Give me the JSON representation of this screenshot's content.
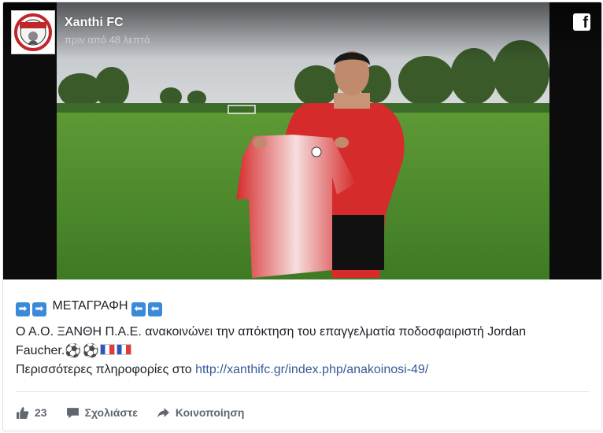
{
  "post": {
    "page_name": "Xanthi FC",
    "time": "πριν από 48 λεπτά",
    "logo_text": "ΞΑΝΘΗ",
    "line1_title": "ΜΕΤΑΓΡΑΦΗ",
    "line2": "Ο Α.Ο. ΞΑΝΘΗ Π.Α.Ε. ανακοινώνει την απόκτηση του επαγγελματία ποδοσφαιριστή Jordan",
    "line3": "Faucher.",
    "line4_prefix": "Περισσότερες πληροφορίες στο ",
    "link_text": "http://xanthifc.gr/index.php/anakoinosi-49/",
    "like_count": "23",
    "comment_label": "Σχολιάστε",
    "share_label": "Κοινοποίηση"
  },
  "icons": {
    "brand": "facebook-icon",
    "like": "thumbs-up-icon",
    "comment": "comment-bubble-icon",
    "share": "share-arrow-icon",
    "arrow_right": "arrow-right-emoji",
    "arrow_left": "arrow-left-emoji",
    "ball": "soccer-ball-emoji",
    "flag": "france-flag-emoji"
  },
  "colors": {
    "link": "#385898",
    "action_text": "#606770",
    "jersey_red": "#d62b2b",
    "grass": "#4f8d2e"
  }
}
